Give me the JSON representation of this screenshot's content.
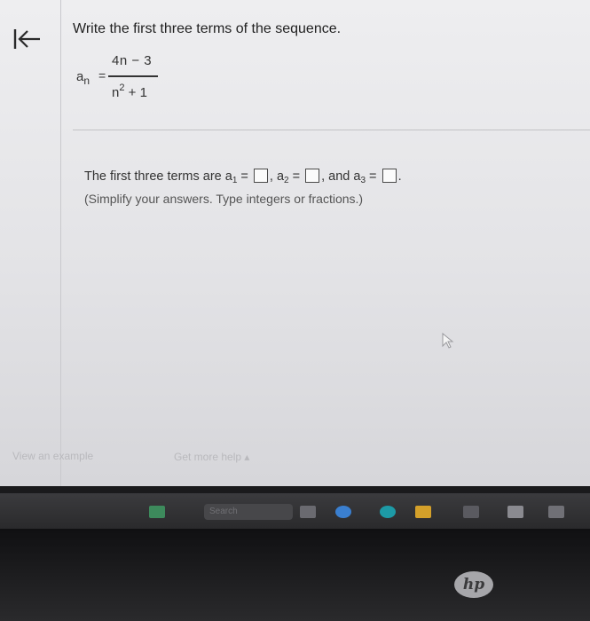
{
  "question": {
    "title": "Write the first three terms of the sequence.",
    "formula": {
      "lhs_base": "a",
      "lhs_sub": "n",
      "equals": "=",
      "numerator": "4n − 3",
      "denominator_base": "n",
      "denominator_exp": "2",
      "denominator_rest": " + 1"
    }
  },
  "answer": {
    "prefix": "The first three terms are a",
    "sub1": "1",
    "eq": " = ",
    "sep": ", a",
    "sub2": "2",
    "and": ", and a",
    "sub3": "3",
    "end": ".",
    "hint": "(Simplify your answers. Type integers or fractions.)"
  },
  "links": {
    "view_example": "View an example",
    "get_help": "Get more help ▴"
  },
  "taskbar": {
    "search_label": "Search"
  },
  "device": {
    "logo": "hp"
  },
  "icons": {
    "back": "back-to-start-icon",
    "cursor": "mouse-cursor-icon"
  }
}
